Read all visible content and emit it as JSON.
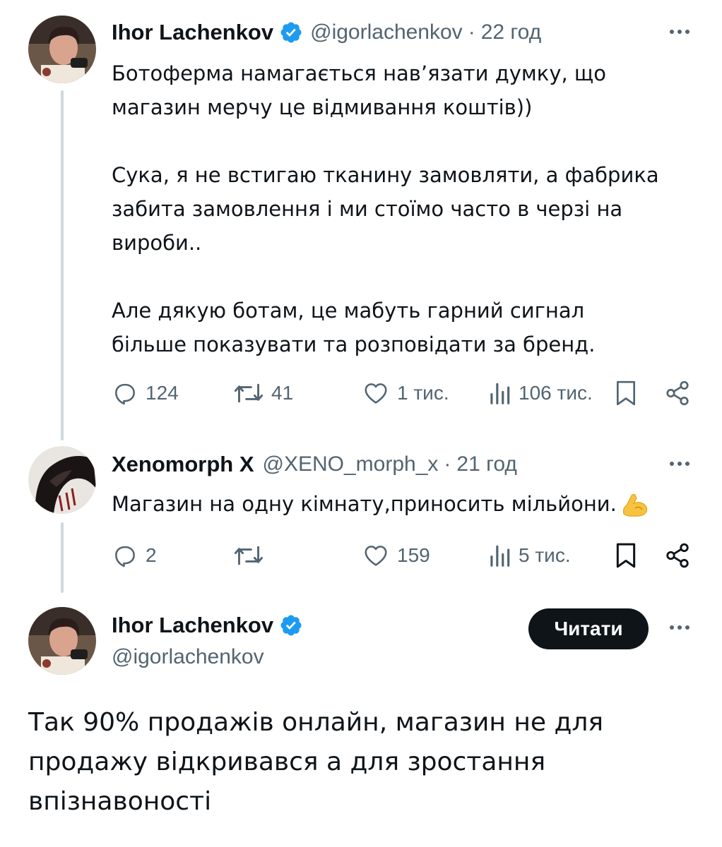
{
  "tweet1": {
    "author_name": "Ihor Lachenkov",
    "handle": "@igorlachenkov",
    "separator": "·",
    "time": "22 год",
    "lines": [
      "Ботоферма намагається нав’язати думку, що",
      "магазин мерчу це відмивання коштів))",
      "",
      "Сука, я не встигаю тканину замовляти, а фабрика",
      "забита замовлення і ми стоїмо часто в черзі на",
      "вироби..",
      "",
      "Але дякую ботам, це мабуть гарний сигнал",
      "більше показувати та розповідати за бренд."
    ],
    "replies": "124",
    "reposts": "41",
    "likes": "1 тис.",
    "views": "106 тис."
  },
  "tweet2": {
    "author_name": "Xenomorph X",
    "handle": "@XENO_morph_x",
    "separator": "·",
    "time": "21 год",
    "text": "Магазин на одну кімнату,приносить мільйони.",
    "emoji": "flexed-biceps",
    "replies": "2",
    "reposts": "",
    "likes": "159",
    "views": "5 тис."
  },
  "tweet3": {
    "author_name": "Ihor Lachenkov",
    "handle": "@igorlachenkov",
    "follow_label": "Читати",
    "lines": [
      "Так 90% продажів онлайн, магазин не для",
      "продажу відкривався а для зростання",
      "впізнавоності"
    ]
  },
  "icons": {
    "more": "more-horizontal-icon",
    "verified": "verified-badge-icon",
    "reply": "reply-icon",
    "repost": "repost-icon",
    "like": "like-icon",
    "views": "views-icon",
    "bookmark": "bookmark-icon",
    "share": "share-icon"
  },
  "colors": {
    "text": "#0f1419",
    "secondary": "#536471",
    "verified": "#1d9bf0",
    "thread_line": "#cfd9de",
    "button_bg": "#0f1419",
    "button_text": "#ffffff"
  }
}
